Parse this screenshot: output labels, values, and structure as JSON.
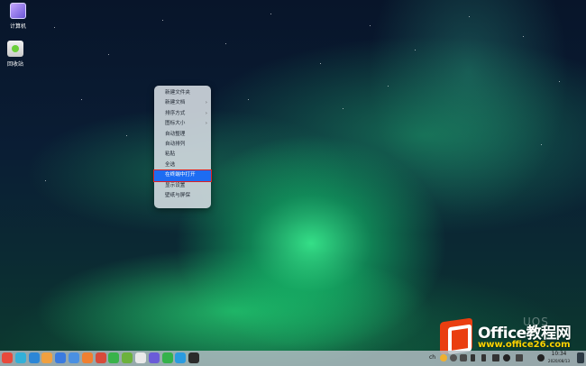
{
  "desktop": {
    "icons": [
      {
        "label": "计算机",
        "icon": "computer-icon"
      },
      {
        "label": "回收站",
        "icon": "trash-icon"
      }
    ]
  },
  "context_menu": {
    "items": [
      {
        "label": "新建文件夹",
        "submenu": false
      },
      {
        "label": "新建文档",
        "submenu": true
      },
      {
        "label": "排序方式",
        "submenu": true
      },
      {
        "label": "图标大小",
        "submenu": true
      },
      {
        "label": "自动整理",
        "submenu": false
      },
      {
        "label": "自动排列",
        "submenu": false
      },
      {
        "label": "粘贴",
        "submenu": false
      },
      {
        "label": "全选",
        "submenu": false
      },
      {
        "label": "在终端中打开",
        "submenu": false,
        "highlighted": true
      },
      {
        "label": "显示设置",
        "submenu": false
      },
      {
        "label": "壁纸与屏保",
        "submenu": false
      }
    ],
    "chevron": "›",
    "highlight_color": "#1d6cf2",
    "outline_color": "#e02020"
  },
  "watermark": {
    "title": "Office教程网",
    "url": "www.office26.com",
    "brand_color": "#ea3e10",
    "uos": "UOS"
  },
  "taskbar": {
    "apps": [
      {
        "icon": "launcher-icon",
        "color": "#e84a3c"
      },
      {
        "icon": "multitask-icon",
        "color": "#33b0d8"
      },
      {
        "icon": "file-manager-icon",
        "color": "#2c86d6"
      },
      {
        "icon": "app-store-icon",
        "color": "#f0a040"
      },
      {
        "icon": "browser-icon",
        "color": "#3a7be0"
      },
      {
        "icon": "music-icon",
        "color": "#4a90e2"
      },
      {
        "icon": "video-icon",
        "color": "#f08030"
      },
      {
        "icon": "mail-icon",
        "color": "#d84a3a"
      },
      {
        "icon": "image-viewer-icon",
        "color": "#39b34a"
      },
      {
        "icon": "calendar-icon",
        "color": "#6cb23c"
      },
      {
        "icon": "text-editor-icon",
        "color": "#e9e9e9"
      },
      {
        "icon": "settings-icon",
        "color": "#6b5cd8"
      },
      {
        "icon": "chat-icon",
        "color": "#34b24a"
      },
      {
        "icon": "store-icon",
        "color": "#2a9be0"
      },
      {
        "icon": "terminal-icon",
        "color": "#2b2b2b"
      }
    ],
    "tray": {
      "input_method": "ch",
      "icons": [
        "chat-tray-icon",
        "notification-tray-icon",
        "shield-tray-icon",
        "edit-tray-icon",
        "pen-tray-icon",
        "volume-tray-icon",
        "bell-tray-icon",
        "network-tray-icon",
        "sun-tray-icon"
      ]
    },
    "clock": {
      "time": "10:34",
      "date": "2020/08/13"
    }
  }
}
